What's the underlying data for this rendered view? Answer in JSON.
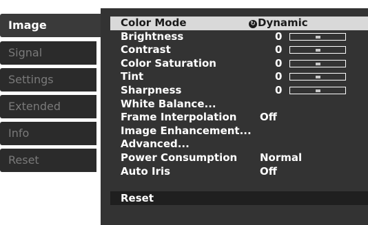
{
  "tabs": [
    {
      "label": "Image",
      "active": true
    },
    {
      "label": "Signal",
      "active": false
    },
    {
      "label": "Settings",
      "active": false
    },
    {
      "label": "Extended",
      "active": false
    },
    {
      "label": "Info",
      "active": false
    },
    {
      "label": "Reset",
      "active": false
    }
  ],
  "menu": {
    "color_mode": {
      "label": "Color Mode",
      "value": "Dynamic",
      "icon": "dynamic-mode-icon"
    },
    "brightness": {
      "label": "Brightness",
      "value": "0",
      "level": 0.5
    },
    "contrast": {
      "label": "Contrast",
      "value": "0",
      "level": 0.5
    },
    "color_saturation": {
      "label": "Color Saturation",
      "value": "0",
      "level": 0.5
    },
    "tint": {
      "label": "Tint",
      "value": "0",
      "level": 0.5
    },
    "sharpness": {
      "label": "Sharpness",
      "value": "0",
      "level": 0.5
    },
    "white_balance": {
      "label": "White Balance..."
    },
    "frame_interpolation": {
      "label": "Frame Interpolation",
      "value": "Off"
    },
    "image_enhancement": {
      "label": "Image Enhancement..."
    },
    "advanced": {
      "label": "Advanced..."
    },
    "power_consumption": {
      "label": "Power Consumption",
      "value": "Normal"
    },
    "auto_iris": {
      "label": "Auto Iris",
      "value": "Off"
    }
  },
  "reset": {
    "label": "Reset"
  },
  "colors": {
    "panel": "#333333",
    "tab": "#2b2b2b",
    "tab_active": "#3a3a3a",
    "selection": "#d9d9d9"
  }
}
